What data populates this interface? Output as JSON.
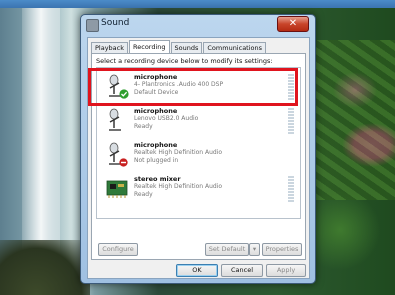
{
  "window": {
    "title": "Sound",
    "close_label": "✕"
  },
  "tabs": [
    "Playback",
    "Recording",
    "Sounds",
    "Communications"
  ],
  "active_tab": "Recording",
  "instruction": "Select a recording device below to modify its settings:",
  "devices": [
    {
      "icon": "microphone-icon",
      "name": "microphone",
      "line1": "4- Plantronics .Audio 400 DSP",
      "line2": "Default Device",
      "status_badge": "default-check-icon",
      "selected": true
    },
    {
      "icon": "microphone-icon",
      "name": "microphone",
      "line1": "Lenovo USB2.0 Audio",
      "line2": "Ready",
      "status_badge": null,
      "selected": false
    },
    {
      "icon": "microphone-icon",
      "name": "microphone",
      "line1": "Realtek High Definition Audio",
      "line2": "Not plugged in",
      "status_badge": "unplugged-icon",
      "selected": false
    },
    {
      "icon": "sound-card-icon",
      "name": "stereo mixer",
      "line1": "Realtek High Definition Audio",
      "line2": "Ready",
      "status_badge": null,
      "selected": false
    }
  ],
  "buttons": {
    "configure": "Configure",
    "set_default": "Set Default",
    "set_default_arrow": "▾",
    "properties": "Properties",
    "ok": "OK",
    "cancel": "Cancel",
    "apply": "Apply"
  },
  "colors": {
    "highlight_box": "#e0141e",
    "close_button": "#c8452a",
    "default_check": "#2e9e2e",
    "unplugged": "#c82020"
  }
}
